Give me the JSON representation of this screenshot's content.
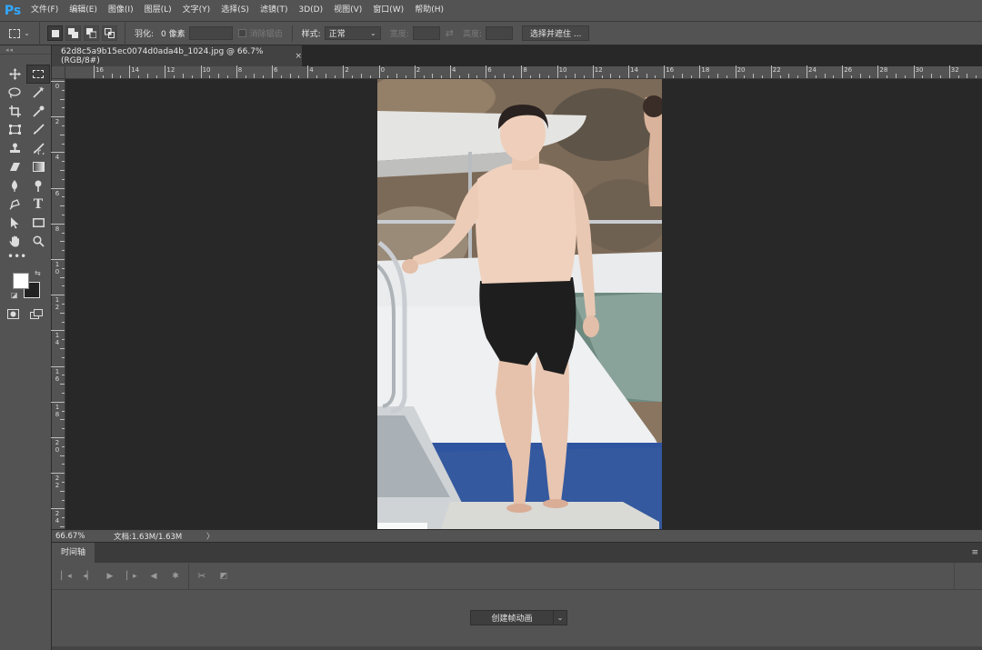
{
  "app": {
    "logo": "Ps"
  },
  "menu": [
    "文件(F)",
    "编辑(E)",
    "图像(I)",
    "图层(L)",
    "文字(Y)",
    "选择(S)",
    "滤镜(T)",
    "3D(D)",
    "视图(V)",
    "窗口(W)",
    "帮助(H)"
  ],
  "options": {
    "feather_label": "羽化:",
    "feather_value": "0 像素",
    "antialias_label": "消除锯齿",
    "style_label": "样式:",
    "style_value": "正常",
    "width_label": "宽度:",
    "height_label": "高度:",
    "select_mask_button": "选择并遮住 ..."
  },
  "document": {
    "tab_title": "62d8c5a9b15ec0074d0ada4b_1024.jpg @ 66.7%(RGB/8#)",
    "close_glyph": "×"
  },
  "rulers": {
    "top_labels": [
      "16",
      "14",
      "12",
      "10",
      "8",
      "6",
      "4",
      "2",
      "0",
      "2",
      "4",
      "6",
      "8",
      "10",
      "12",
      "14",
      "16",
      "18",
      "20",
      "22",
      "24",
      "26",
      "28",
      "30",
      "32"
    ],
    "left_labels": [
      "0",
      "2",
      "4",
      "6",
      "8",
      "1 0",
      "1 2",
      "1 4",
      "1 6",
      "1 8",
      "2 0",
      "2 2",
      "2 4"
    ]
  },
  "status": {
    "zoom": "66.67%",
    "doc_info": "文档:1.63M/1.63M",
    "arrow": "〉"
  },
  "timeline": {
    "tab_label": "时间轴",
    "create_button": "创建帧动画",
    "menu_glyph": "≡"
  },
  "colors": {
    "ui_panel": "#535353",
    "canvas_bg": "#282828",
    "foreground_color": "#ffffff",
    "background_color": "#222222",
    "accent": "#31a8ff"
  }
}
